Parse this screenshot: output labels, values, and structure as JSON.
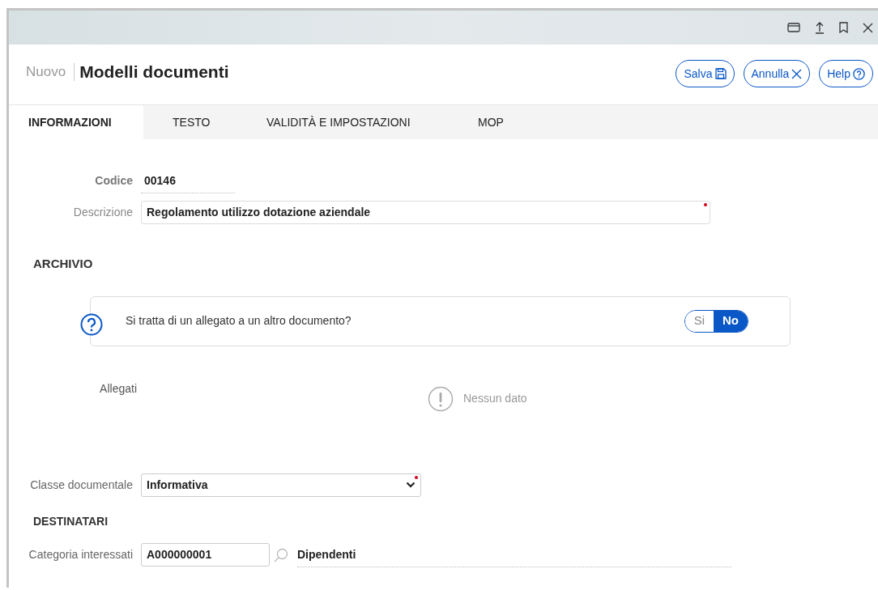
{
  "header": {
    "prefix": "Nuovo",
    "title": "Modelli documenti",
    "buttons": [
      {
        "label": "Salva",
        "kind": "save"
      },
      {
        "label": "Annulla",
        "kind": "cancel"
      },
      {
        "label": "Help",
        "kind": "help"
      }
    ]
  },
  "tabs": [
    {
      "label": "INFORMAZIONI",
      "selected": true
    },
    {
      "label": "TESTO",
      "selected": false
    },
    {
      "label": "VALIDITÀ E IMPOSTAZIONI",
      "selected": false
    },
    {
      "label": "MOP",
      "selected": false
    }
  ],
  "codice": {
    "label": "Codice",
    "value": "00146"
  },
  "descrizione": {
    "label": "Descrizione",
    "value": "Regolamento utilizzo dotazione aziendale",
    "required": true
  },
  "archivio": {
    "title": "ARCHIVIO",
    "question": "Si tratta di un allegato a un altro documento?",
    "options": [
      {
        "label": "Si",
        "selected": false
      },
      {
        "label": "No",
        "selected": true
      }
    ]
  },
  "allegati": {
    "label": "Allegati",
    "empty": "Nessun dato"
  },
  "classe": {
    "label": "Classe documentale",
    "value": "Informativa",
    "required": true
  },
  "destinatari": {
    "title": "DESTINATARI",
    "label": "Categoria interessati",
    "code": "A000000001",
    "name": "Dipendenti"
  }
}
